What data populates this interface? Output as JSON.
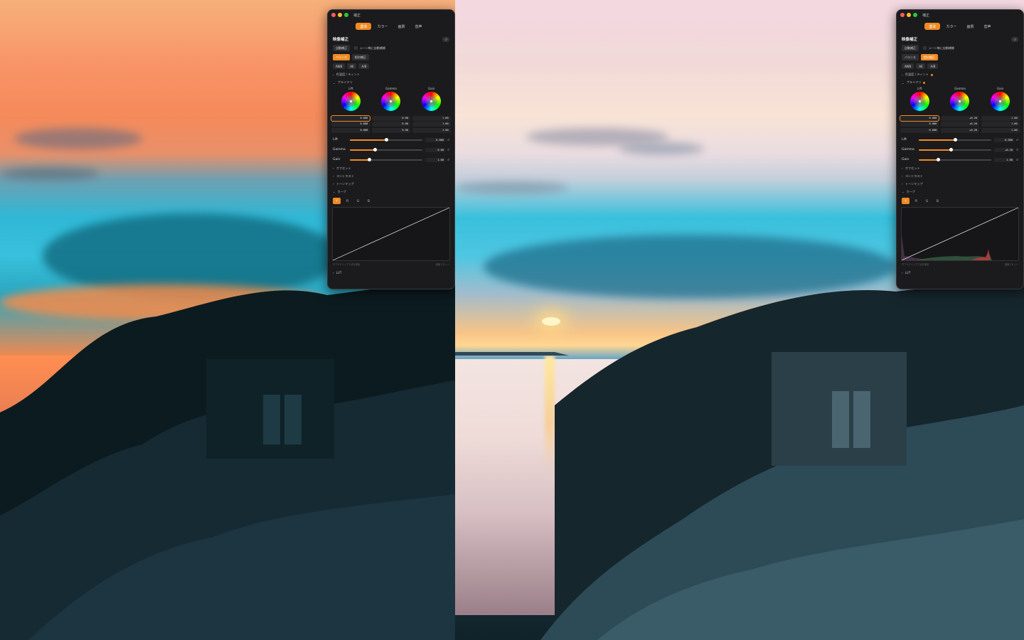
{
  "panel": {
    "window_title": "補正",
    "tabs": [
      "基本",
      "カラー",
      "画質",
      "音声"
    ],
    "active_tab": 0,
    "section_title": "映像補正",
    "auto_correct_label": "自動補正",
    "scene_auto_label": "シーン毎に自動補補",
    "mode_tabs": [
      "バランス",
      "相対補正"
    ],
    "wb_buttons": [
      "AWB",
      "AE",
      "A/B"
    ],
    "sections": {
      "temp_tint": "色温度 / ティント",
      "primary": "プライマリ",
      "offset": "オフセット",
      "contrast": "コントラスト",
      "tonemap": "トーンマップ",
      "curve": "カーブ",
      "lut": "LUT"
    },
    "wheel_names": [
      "Lift",
      "Gamma",
      "Gain"
    ],
    "slider_names": [
      "Lift",
      "Gamma",
      "Gain"
    ],
    "channels": [
      "Y",
      "R",
      "G",
      "B"
    ],
    "curve_hint_left": "ダブルクリックで点を追加",
    "curve_hint_right": "曲線リセット"
  },
  "left": {
    "active_mode": 0,
    "wheel_values": [
      [
        "0.000",
        "0.000",
        "0.000"
      ],
      [
        "0.00",
        "0.00",
        "0.00"
      ],
      [
        "1.00",
        "1.00",
        "1.00"
      ]
    ],
    "slider_values": [
      "0.000",
      "0.00",
      "1.00"
    ],
    "slider_levels": [
      0.5,
      0.35,
      0.27
    ],
    "show_dots": false
  },
  "right": {
    "active_mode": 1,
    "wheel_values": [
      [
        "0.000",
        "0.000",
        "0.000"
      ],
      [
        "+0.20",
        "+0.20",
        "+0.20"
      ],
      [
        "1.00",
        "1.00",
        "1.00"
      ]
    ],
    "slider_values": [
      "0.000",
      "+0.20",
      "1.00"
    ],
    "slider_levels": [
      0.5,
      0.45,
      0.27
    ],
    "show_dots": true
  }
}
